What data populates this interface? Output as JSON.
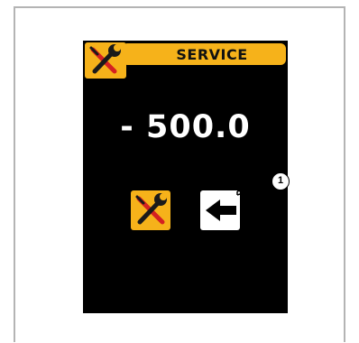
{
  "header": {
    "title": "SERVICE",
    "icon": "wrench-screwdriver-icon"
  },
  "display": {
    "value": "- 500.0"
  },
  "buttons": {
    "service": {
      "icon": "wrench-screwdriver-icon"
    },
    "back": {
      "icon": "arrow-left-icon"
    }
  },
  "callout": {
    "number": "1"
  },
  "colors": {
    "accent": "#f6b21a",
    "screen_bg": "#000000",
    "text": "#ffffff"
  }
}
